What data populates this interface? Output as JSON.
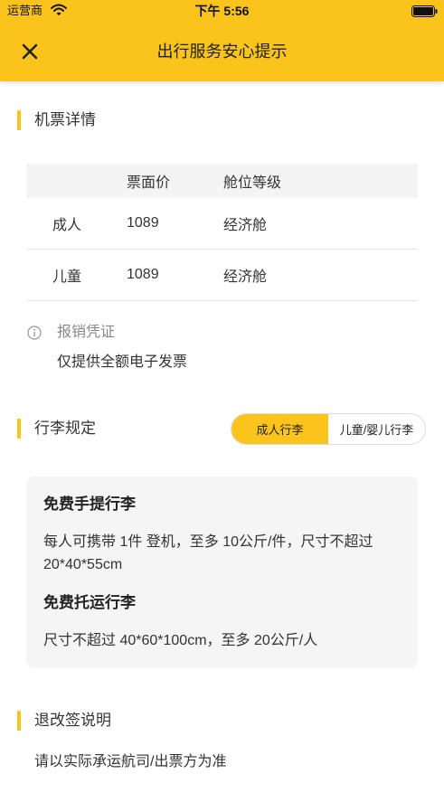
{
  "theme": {
    "accent": "#FBC41D",
    "card_background": "#F5F5F5",
    "text": "#222222",
    "muted": "#888888"
  },
  "status_bar": {
    "carrier": "运营商",
    "time": "下午 5:56",
    "wifi_icon": "wifi-icon",
    "battery_icon": "battery-icon",
    "battery_level": 1.0
  },
  "nav": {
    "title": "出行服务安心提示",
    "close_icon": "close-icon"
  },
  "ticket_section": {
    "title": "机票详情",
    "headers": [
      "",
      "票面价",
      "舱位等级"
    ],
    "rows": [
      {
        "type": "成人",
        "price": "1089",
        "cabin": "经济舱"
      },
      {
        "type": "儿童",
        "price": "1089",
        "cabin": "经济舱"
      }
    ],
    "reimbursement": {
      "icon": "info-icon",
      "label": "报销凭证",
      "value": "仅提供全额电子发票"
    }
  },
  "baggage_section": {
    "title": "行李规定",
    "tabs": [
      {
        "label": "成人行李",
        "active": true
      },
      {
        "label": "儿童/婴儿行李",
        "active": false
      }
    ],
    "carry_on": {
      "title": "免费手提行李",
      "text": "每人可携带 1件 登机，至多 10公斤/件，尺寸不超过 20*40*55cm"
    },
    "checked": {
      "title": "免费托运行李",
      "text": "尺寸不超过 40*60*100cm，至多 20公斤/人"
    }
  },
  "refund_section": {
    "title": "退改签说明",
    "text": "请以实际承运航司/出票方为准"
  }
}
